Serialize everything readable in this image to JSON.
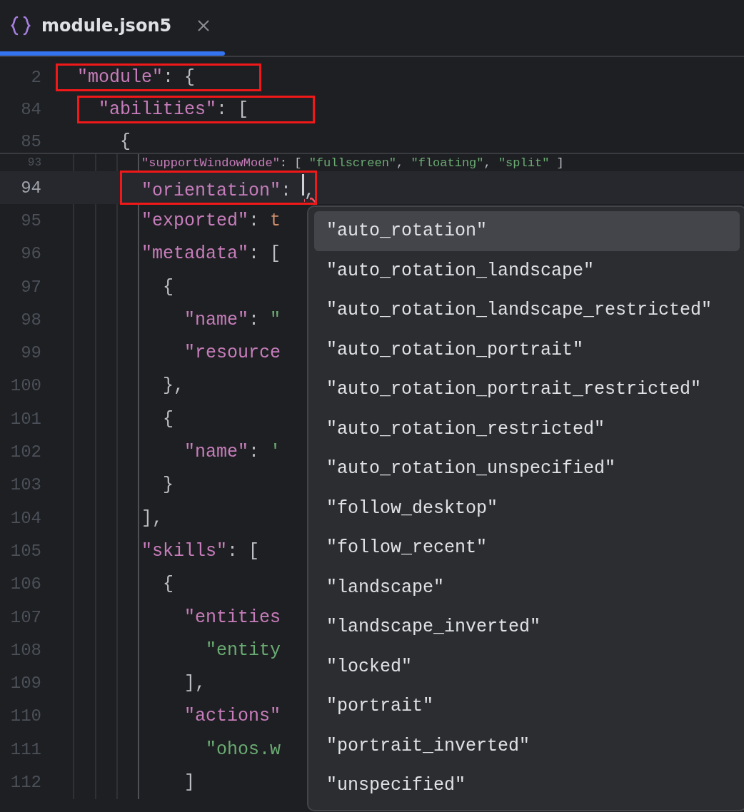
{
  "tab": {
    "title": "module.json5",
    "selected": true
  },
  "lines": [
    {
      "number": "2",
      "kind": "pinned",
      "boxed": true,
      "current": false,
      "tokens": [
        {
          "kind": "key",
          "text": "\"module\""
        },
        {
          "kind": "punct",
          "text": ": {"
        }
      ],
      "children": [
        {
          "number": "84",
          "kind": "pinned",
          "boxed": true,
          "current": false,
          "tokens": [
            {
              "kind": "key",
              "text": "\"abilities\""
            },
            {
              "kind": "punct",
              "text": ": ["
            }
          ],
          "children": [
            {
              "number": "85",
              "kind": "pinned",
              "boxed": false,
              "current": false,
              "tokens": [
                {
                  "kind": "punct",
                  "text": "{"
                }
              ],
              "children": [
                {
                  "number": "93",
                  "kind": "partial",
                  "boxed": false,
                  "current": false,
                  "tokens": [
                    {
                      "kind": "key",
                      "text": "\"supportWindowMode\""
                    },
                    {
                      "kind": "punct",
                      "text": ": [ "
                    },
                    {
                      "kind": "string",
                      "text": "\"fullscreen\""
                    },
                    {
                      "kind": "punct",
                      "text": ", "
                    },
                    {
                      "kind": "string",
                      "text": "\"floating\""
                    },
                    {
                      "kind": "punct",
                      "text": ", "
                    },
                    {
                      "kind": "string",
                      "text": "\"split\""
                    },
                    {
                      "kind": "punct",
                      "text": " ]"
                    }
                  ]
                },
                {
                  "number": "94",
                  "kind": "normal",
                  "boxed": true,
                  "current": true,
                  "tokens": [
                    {
                      "kind": "key",
                      "text": "\"orientation\""
                    },
                    {
                      "kind": "punct",
                      "text": ": "
                    },
                    {
                      "kind": "caret"
                    },
                    {
                      "kind": "error",
                      "text": ","
                    }
                  ]
                },
                {
                  "number": "95",
                  "kind": "normal",
                  "boxed": false,
                  "current": false,
                  "tokens": [
                    {
                      "kind": "key",
                      "text": "\"exported\""
                    },
                    {
                      "kind": "punct",
                      "text": ": "
                    },
                    {
                      "kind": "keyword",
                      "text": "t"
                    }
                  ]
                },
                {
                  "number": "96",
                  "kind": "normal",
                  "boxed": false,
                  "current": false,
                  "tokens": [
                    {
                      "kind": "key",
                      "text": "\"metadata\""
                    },
                    {
                      "kind": "punct",
                      "text": ": ["
                    }
                  ],
                  "children": [
                    {
                      "number": "97",
                      "kind": "normal",
                      "boxed": false,
                      "current": false,
                      "tokens": [
                        {
                          "kind": "punct",
                          "text": "{"
                        }
                      ],
                      "children": [
                        {
                          "number": "98",
                          "kind": "normal",
                          "boxed": false,
                          "current": false,
                          "tokens": [
                            {
                              "kind": "key",
                              "text": "\"name\""
                            },
                            {
                              "kind": "punct",
                              "text": ": "
                            },
                            {
                              "kind": "string",
                              "text": "\""
                            }
                          ]
                        },
                        {
                          "number": "99",
                          "kind": "normal",
                          "boxed": false,
                          "current": false,
                          "tokens": [
                            {
                              "kind": "key",
                              "text": "\"resource"
                            }
                          ]
                        }
                      ]
                    },
                    {
                      "number": "100",
                      "kind": "normal",
                      "boxed": false,
                      "current": false,
                      "tokens": [
                        {
                          "kind": "punct",
                          "text": "},"
                        }
                      ]
                    },
                    {
                      "number": "101",
                      "kind": "normal",
                      "boxed": false,
                      "current": false,
                      "tokens": [
                        {
                          "kind": "punct",
                          "text": "{"
                        }
                      ],
                      "children": [
                        {
                          "number": "102",
                          "kind": "normal",
                          "boxed": false,
                          "current": false,
                          "tokens": [
                            {
                              "kind": "key",
                              "text": "\"name\""
                            },
                            {
                              "kind": "punct",
                              "text": ": "
                            },
                            {
                              "kind": "string",
                              "text": "'"
                            }
                          ]
                        }
                      ]
                    },
                    {
                      "number": "103",
                      "kind": "normal",
                      "boxed": false,
                      "current": false,
                      "tokens": [
                        {
                          "kind": "punct",
                          "text": "}"
                        }
                      ]
                    }
                  ]
                },
                {
                  "number": "104",
                  "kind": "normal",
                  "boxed": false,
                  "current": false,
                  "tokens": [
                    {
                      "kind": "punct",
                      "text": "],"
                    }
                  ]
                },
                {
                  "number": "105",
                  "kind": "normal",
                  "boxed": false,
                  "current": false,
                  "tokens": [
                    {
                      "kind": "key",
                      "text": "\"skills\""
                    },
                    {
                      "kind": "punct",
                      "text": ": ["
                    }
                  ],
                  "children": [
                    {
                      "number": "106",
                      "kind": "normal",
                      "boxed": false,
                      "current": false,
                      "tokens": [
                        {
                          "kind": "punct",
                          "text": "{"
                        }
                      ],
                      "children": [
                        {
                          "number": "107",
                          "kind": "normal",
                          "boxed": false,
                          "current": false,
                          "tokens": [
                            {
                              "kind": "key",
                              "text": "\"entities"
                            }
                          ],
                          "children": [
                            {
                              "number": "108",
                              "kind": "normal",
                              "boxed": false,
                              "current": false,
                              "tokens": [
                                {
                                  "kind": "string",
                                  "text": "\"entity"
                                }
                              ]
                            }
                          ]
                        },
                        {
                          "number": "109",
                          "kind": "normal",
                          "boxed": false,
                          "current": false,
                          "tokens": [
                            {
                              "kind": "punct",
                              "text": "],"
                            }
                          ]
                        },
                        {
                          "number": "110",
                          "kind": "normal",
                          "boxed": false,
                          "current": false,
                          "tokens": [
                            {
                              "kind": "key",
                              "text": "\"actions\""
                            }
                          ],
                          "children": [
                            {
                              "number": "111",
                              "kind": "normal",
                              "boxed": false,
                              "current": false,
                              "tokens": [
                                {
                                  "kind": "string",
                                  "text": "\"ohos.w"
                                }
                              ]
                            }
                          ]
                        },
                        {
                          "number": "112",
                          "kind": "normal",
                          "boxed": false,
                          "current": false,
                          "tokens": [
                            {
                              "kind": "punct",
                              "text": "]"
                            }
                          ]
                        }
                      ]
                    }
                  ]
                }
              ]
            }
          ]
        }
      ]
    }
  ],
  "completion": [
    {
      "label": "\"auto_rotation\"",
      "selected": true
    },
    {
      "label": "\"auto_rotation_landscape\"",
      "selected": false
    },
    {
      "label": "\"auto_rotation_landscape_restricted\"",
      "selected": false
    },
    {
      "label": "\"auto_rotation_portrait\"",
      "selected": false
    },
    {
      "label": "\"auto_rotation_portrait_restricted\"",
      "selected": false
    },
    {
      "label": "\"auto_rotation_restricted\"",
      "selected": false
    },
    {
      "label": "\"auto_rotation_unspecified\"",
      "selected": false
    },
    {
      "label": "\"follow_desktop\"",
      "selected": false
    },
    {
      "label": "\"follow_recent\"",
      "selected": false
    },
    {
      "label": "\"landscape\"",
      "selected": false
    },
    {
      "label": "\"landscape_inverted\"",
      "selected": false
    },
    {
      "label": "\"locked\"",
      "selected": false
    },
    {
      "label": "\"portrait\"",
      "selected": false
    },
    {
      "label": "\"portrait_inverted\"",
      "selected": false
    },
    {
      "label": "\"unspecified\"",
      "selected": false
    }
  ]
}
